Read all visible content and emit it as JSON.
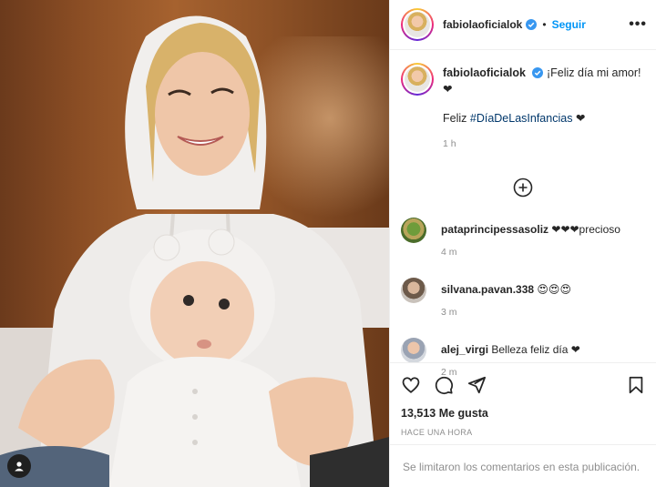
{
  "post": {
    "author": {
      "username": "fabiolaoficialok",
      "verified": true,
      "follow_label": "Seguir",
      "separator": "•"
    },
    "more_label": "•••",
    "caption": {
      "username": "fabiolaoficialok",
      "line1": "¡Feliz día mi amor!",
      "line1_emoji": "❤",
      "line2_prefix": "Feliz ",
      "hashtag": "#DíaDeLasInfancias",
      "line2_suffix": " ❤",
      "time": "1 h"
    },
    "comments": [
      {
        "username": "pataprincipessasoliz",
        "text": "❤❤❤precioso",
        "time": "4 m"
      },
      {
        "username": "silvana.pavan.338",
        "text": "😍😍😍",
        "time": "3 m"
      },
      {
        "username": "alej_virgi",
        "text": "Belleza feliz día ❤",
        "time": "2 m"
      }
    ],
    "likes": "13,513 Me gusta",
    "posted": "HACE UNA HORA",
    "comments_limited": "Se limitaron los comentarios en esta publicación.",
    "icons": [
      "heart-icon",
      "comment-icon",
      "share-icon",
      "bookmark-icon",
      "add-circle-icon",
      "more-icon",
      "verified-icon",
      "user-tag-icon"
    ],
    "colors": {
      "accent": "#0095f6",
      "verified": "#3897f0",
      "muted": "#8e8e8e",
      "text": "#262626"
    }
  }
}
